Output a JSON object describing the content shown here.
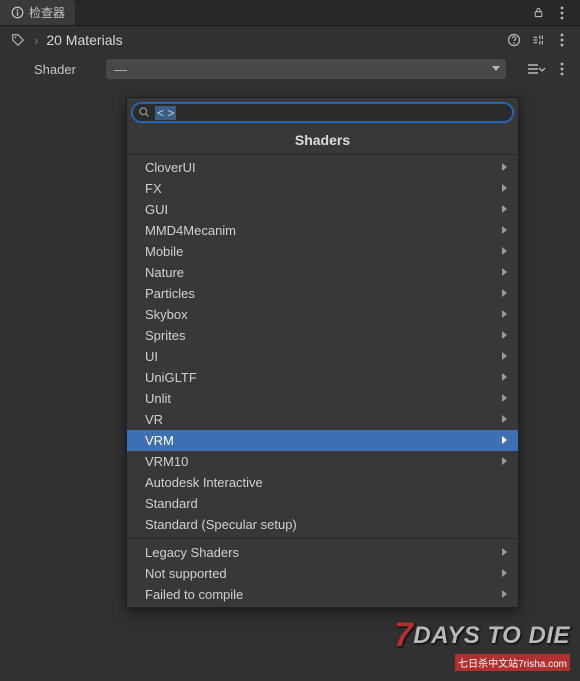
{
  "tab": {
    "title": "检查器"
  },
  "header": {
    "title": "20 Materials"
  },
  "shader": {
    "label": "Shader",
    "value": "—"
  },
  "dropdown": {
    "search_value": "< >",
    "title": "Shaders",
    "groups": [
      [
        {
          "label": "CloverUI",
          "sub": true
        },
        {
          "label": "FX",
          "sub": true
        },
        {
          "label": "GUI",
          "sub": true
        },
        {
          "label": "MMD4Mecanim",
          "sub": true
        },
        {
          "label": "Mobile",
          "sub": true
        },
        {
          "label": "Nature",
          "sub": true
        },
        {
          "label": "Particles",
          "sub": true
        },
        {
          "label": "Skybox",
          "sub": true
        },
        {
          "label": "Sprites",
          "sub": true
        },
        {
          "label": "UI",
          "sub": true
        },
        {
          "label": "UniGLTF",
          "sub": true
        },
        {
          "label": "Unlit",
          "sub": true
        },
        {
          "label": "VR",
          "sub": true
        },
        {
          "label": "VRM",
          "sub": true,
          "selected": true
        },
        {
          "label": "VRM10",
          "sub": true
        },
        {
          "label": "Autodesk Interactive",
          "sub": false
        },
        {
          "label": "Standard",
          "sub": false
        },
        {
          "label": "Standard (Specular setup)",
          "sub": false
        }
      ],
      [
        {
          "label": "Legacy Shaders",
          "sub": true
        },
        {
          "label": "Not supported",
          "sub": true
        },
        {
          "label": "Failed to compile",
          "sub": true
        }
      ]
    ]
  },
  "watermark": {
    "main_prefix": "7",
    "main_text": "DAYS TO DIE",
    "sub": "七日杀中文站7risha.com"
  }
}
